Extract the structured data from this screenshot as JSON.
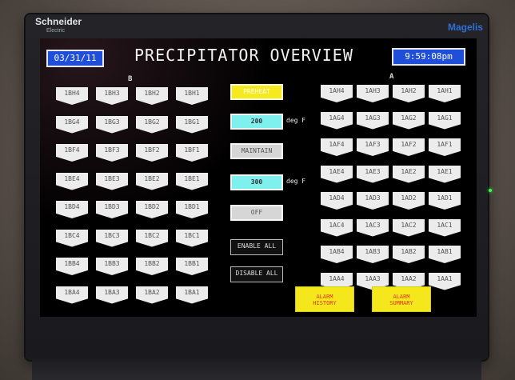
{
  "device": {
    "brand": "Schneider",
    "brand_sub": "Electric",
    "model": "Magelis",
    "led_color": "#39ff4a"
  },
  "header": {
    "date": "03/31/11",
    "title": "PRECIPITATOR OVERVIEW",
    "time": "9:59:08pm"
  },
  "group_b": {
    "label": "B",
    "rows": [
      [
        "1BH4",
        "1BH3",
        "1BH2",
        "1BH1"
      ],
      [
        "1BG4",
        "1BG3",
        "1BG2",
        "1BG1"
      ],
      [
        "1BF4",
        "1BF3",
        "1BF2",
        "1BF1"
      ],
      [
        "1BE4",
        "1BE3",
        "1BE2",
        "1BE1"
      ],
      [
        "1BD4",
        "1BD3",
        "1BD2",
        "1BD1"
      ],
      [
        "1BC4",
        "1BC3",
        "1BC2",
        "1BC1"
      ],
      [
        "1BB4",
        "1BB3",
        "1BB2",
        "1BB1"
      ],
      [
        "1BA4",
        "1BA3",
        "1BA2",
        "1BA1"
      ]
    ]
  },
  "group_a": {
    "label": "A",
    "rows": [
      [
        "1AH4",
        "1AH3",
        "1AH2",
        "1AH1"
      ],
      [
        "1AG4",
        "1AG3",
        "1AG2",
        "1AG1"
      ],
      [
        "1AF4",
        "1AF3",
        "1AF2",
        "1AF1"
      ],
      [
        "1AE4",
        "1AE3",
        "1AE2",
        "1AE1"
      ],
      [
        "1AD4",
        "1AD3",
        "1AD2",
        "1AD1"
      ],
      [
        "1AC4",
        "1AC3",
        "1AC2",
        "1AC1"
      ],
      [
        "1AB4",
        "1AB3",
        "1AB2",
        "1AB1"
      ],
      [
        "1AA4",
        "1AA3",
        "1AA2",
        "1AA1"
      ]
    ]
  },
  "controls": {
    "preheat": "PREHEAT",
    "preheat_temp": "200",
    "maintain": "MAINTAIN",
    "maintain_temp": "300",
    "deg_unit": "deg F",
    "off": "OFF",
    "enable_all": "ENABLE ALL",
    "disable_all": "DISABLE ALL"
  },
  "alarms": {
    "history": [
      "ALARM",
      "HISTORY"
    ],
    "summary": [
      "ALARM",
      "SUMMARY"
    ]
  },
  "colors": {
    "header_blue": "#1f4fd8",
    "active_yellow": "#f5ea1e",
    "setpoint_cyan": "#7ef0ee",
    "tag_white": "#ececec",
    "alarm_text": "#e0391a"
  }
}
